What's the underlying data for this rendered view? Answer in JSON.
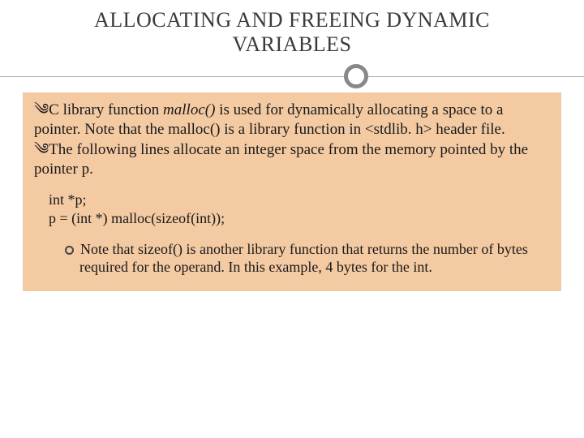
{
  "title": "ALLOCATING AND FREEING DYNAMIC VARIABLES",
  "bullets": {
    "b1_pre": "C library function ",
    "b1_em": "malloc()",
    "b1_post": " is used for dynamically allocating a space to a pointer. Note that the malloc() is a library function in <stdlib. h> header file.",
    "b2": "The following lines allocate an integer space from the memory pointed by the pointer p."
  },
  "code": {
    "line1": "int *p;",
    "line2": "p = (int *) malloc(sizeof(int));"
  },
  "sub": {
    "s1": "Note that sizeof() is another library function that returns the number of bytes required for the operand. In this example, 4 bytes for the int."
  },
  "icons": {
    "swirl": "༄"
  }
}
